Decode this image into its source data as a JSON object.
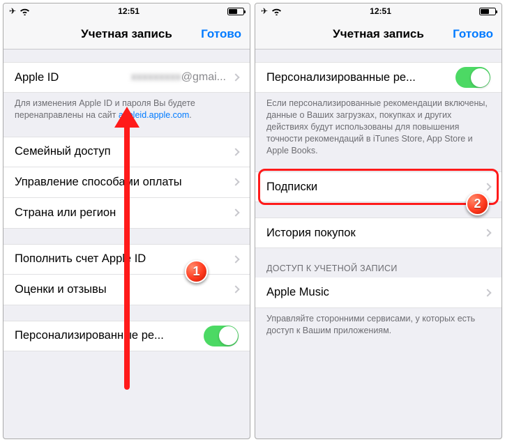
{
  "status": {
    "time": "12:51"
  },
  "nav": {
    "title": "Учетная запись",
    "done": "Готово"
  },
  "left": {
    "apple_id": {
      "label": "Apple ID",
      "value": "@gmai..."
    },
    "apple_id_footer_prefix": "Для изменения Apple ID и пароля Вы будете перенаправлены на сайт ",
    "apple_id_footer_link": "appleid.apple.com",
    "apple_id_footer_suffix": ".",
    "family_sharing": "Семейный доступ",
    "payment_methods": "Управление способами оплаты",
    "country": "Страна или регион",
    "add_funds": "Пополнить счет Apple ID",
    "ratings": "Оценки и отзывы",
    "personalized": "Персонализированные ре...",
    "badge1": "1"
  },
  "right": {
    "personalized": "Персонализированные ре...",
    "personalized_footer": "Если персонализированные рекомендации включены, данные о Ваших загрузках, покупках и других действиях будут использованы для повышения точности рекомендаций в iTunes Store, App Store и Apple Books.",
    "subscriptions": "Подписки",
    "purchase_history": "История покупок",
    "account_access_header": "ДОСТУП К УЧЕТНОЙ ЗАПИСИ",
    "apple_music": "Apple Music",
    "access_footer": "Управляйте сторонними сервисами, у которых есть доступ к Вашим приложениям.",
    "badge2": "2"
  }
}
